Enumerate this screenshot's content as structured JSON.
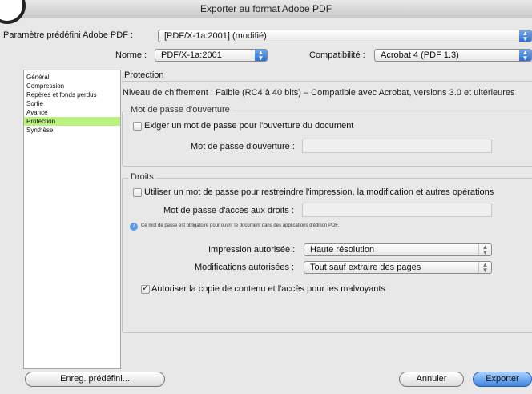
{
  "window": {
    "title": "Exporter au format Adobe PDF"
  },
  "preset": {
    "label": "Paramètre prédéfini Adobe PDF :",
    "value": "[PDF/X-1a:2001] (modifié)"
  },
  "norme": {
    "label": "Norme :",
    "value": "PDF/X-1a:2001"
  },
  "compat": {
    "label": "Compatibilité :",
    "value": "Acrobat 4 (PDF 1.3)"
  },
  "sidebar": {
    "items": [
      {
        "label": "Général"
      },
      {
        "label": "Compression"
      },
      {
        "label": "Repères et fonds perdus"
      },
      {
        "label": "Sortie"
      },
      {
        "label": "Avancé"
      },
      {
        "label": "Protection"
      },
      {
        "label": "Synthèse"
      }
    ]
  },
  "main": {
    "section_title": "Protection",
    "encryption_text": "Niveau de chiffrement : Faible (RC4 à 40 bits) – Compatible avec Acrobat, versions 3.0 et ultérieures",
    "open_password": {
      "legend": "Mot de passe d'ouverture",
      "checkbox_label": "Exiger un mot de passe pour l'ouverture du document",
      "field_label": "Mot de passe d'ouverture :",
      "field_value": ""
    },
    "permissions": {
      "legend": "Droits",
      "checkbox_label": "Utiliser un mot de passe pour restreindre l'impression, la modification et autres opérations",
      "field_label": "Mot de passe d'accès aux droits :",
      "field_value": "",
      "info_text": "Ce mot de passe est obligatoire pour ouvrir le document dans des applications d'édition PDF.",
      "printing_label": "Impression autorisée :",
      "printing_value": "Haute résolution",
      "changes_label": "Modifications autorisées :",
      "changes_value": "Tout sauf extraire des pages",
      "copy_label": "Autoriser la copie de contenu et l'accès pour les malvoyants",
      "copy_checked": true
    }
  },
  "footer": {
    "save_preset": "Enreg. prédéfini...",
    "cancel": "Annuler",
    "export": "Exporter"
  },
  "colors": {
    "sidebar_selected": "#b9f27c",
    "accent": "#3d86e3"
  }
}
